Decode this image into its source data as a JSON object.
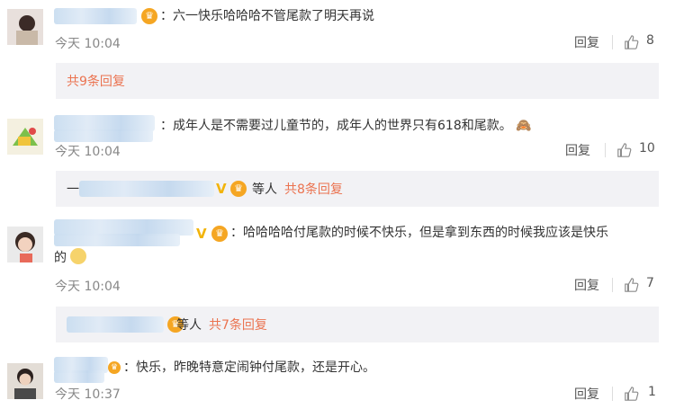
{
  "comments": [
    {
      "text": "：六一快乐哈哈哈不管尾款了明天再说",
      "time": "今天 10:04",
      "reply_label": "回复",
      "likes": "8",
      "sub_summary": {
        "others": "",
        "count_label": "共9条回复"
      }
    },
    {
      "text": "：成年人是不需要过儿童节的，成年人的世界只有618和尾款。",
      "emoji": "🙈",
      "time": "今天 10:04",
      "reply_label": "回复",
      "likes": "10",
      "sub_summary": {
        "prefix": "一",
        "others": "等人",
        "count_label": "共8条回复"
      }
    },
    {
      "text_line1": "哈哈哈哈付尾款的时候不快乐，但是拿到东西的时候我应该是快乐",
      "text_line2": "的",
      "time": "今天 10:04",
      "reply_label": "回复",
      "likes": "7",
      "sub_summary": {
        "others": "等人",
        "count_label": "共7条回复"
      }
    },
    {
      "text": "：快乐，昨晚特意定闹钟付尾款，还是开心。",
      "time": "今天 10:37",
      "reply_label": "回复",
      "likes": "1"
    }
  ],
  "colors": {
    "accent": "#eb7350",
    "subbox_bg": "#f2f2f5",
    "muted": "#888888"
  }
}
